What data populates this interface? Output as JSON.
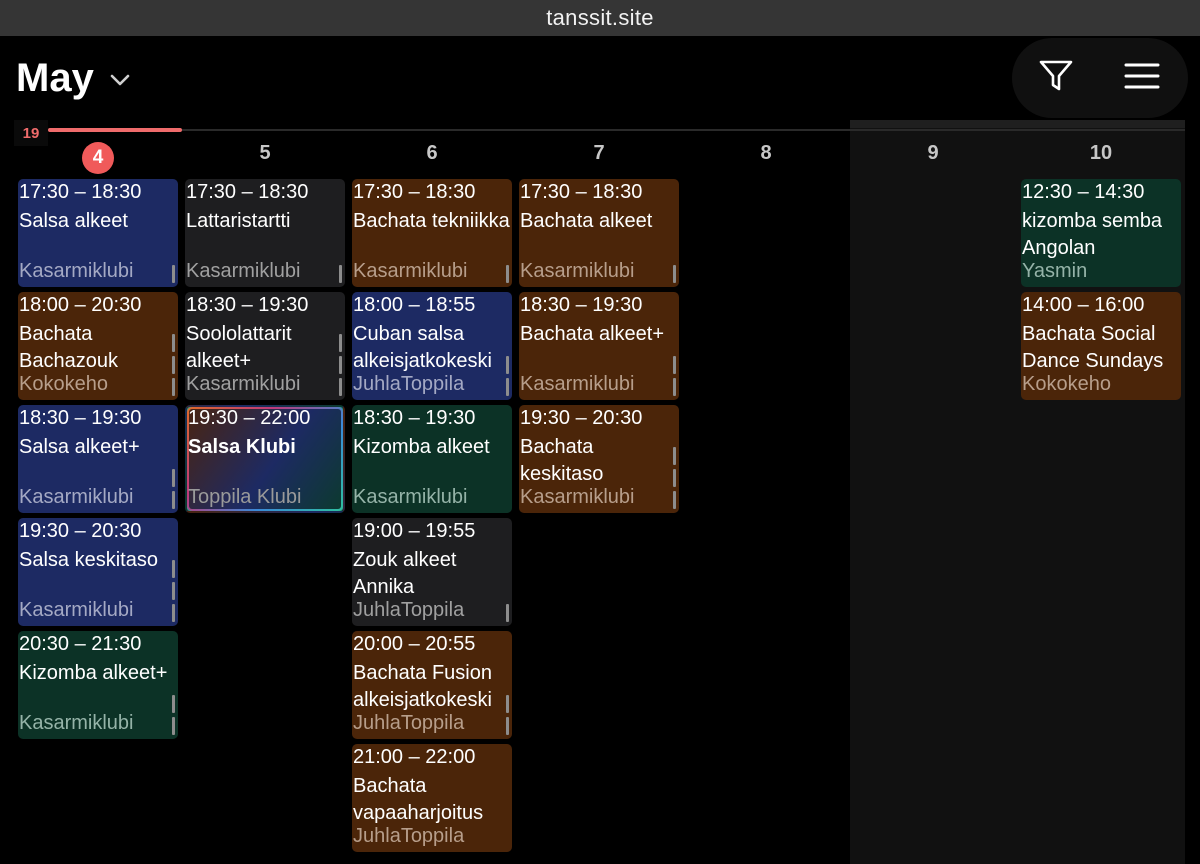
{
  "browser": {
    "url": "tanssit.site"
  },
  "header": {
    "month": "May",
    "month_icon": "chevron-down-icon",
    "filter_icon": "filter-icon",
    "menu_icon": "hamburger-menu-icon"
  },
  "week": {
    "number": "19"
  },
  "days": [
    {
      "label": "4",
      "today": true
    },
    {
      "label": "5"
    },
    {
      "label": "6"
    },
    {
      "label": "7"
    },
    {
      "label": "8"
    },
    {
      "label": "9"
    },
    {
      "label": "10"
    }
  ],
  "events": {
    "d4": [
      {
        "time": "17:30 – 18:30",
        "name": "Salsa alkeet",
        "location": "Kasarmiklubi",
        "color": "#1d2a63"
      },
      {
        "time": "18:00 – 20:30",
        "name": "Bachata Bachazouk",
        "location": "Kokokeho",
        "color": "#4b2509"
      },
      {
        "time": "18:30 – 19:30",
        "name": "Salsa alkeet+",
        "location": "Kasarmiklubi",
        "color": "#1d2a63"
      },
      {
        "time": "19:30 – 20:30",
        "name": "Salsa keskitaso",
        "location": "Kasarmiklubi",
        "color": "#1d2a63"
      },
      {
        "time": "20:30 – 21:30",
        "name": "Kizomba alkeet+",
        "location": "Kasarmiklubi",
        "color": "#0c3226"
      }
    ],
    "d5": [
      {
        "time": "17:30 – 18:30",
        "name": "Lattaristartti",
        "location": "Kasarmiklubi",
        "color": "#1e1e20"
      },
      {
        "time": "18:30 – 19:30",
        "name": "Soololattarit alkeet+",
        "location": "Kasarmiklubi",
        "color": "#1e1e20"
      },
      {
        "time": "19:30 – 22:00",
        "name": "Salsa Klubi",
        "location": "Toppila Klubi",
        "color": "gradient"
      }
    ],
    "d6": [
      {
        "time": "17:30 – 18:30",
        "name": "Bachata tekniikka",
        "location": "Kasarmiklubi",
        "color": "#4b2509"
      },
      {
        "time": "18:00 – 18:55",
        "name": "Cuban salsa alkeisjatkokeski",
        "location": "JuhlaToppila",
        "color": "#1d2a63"
      },
      {
        "time": "18:30 – 19:30",
        "name": "Kizomba alkeet",
        "location": "Kasarmiklubi",
        "color": "#0c3226"
      },
      {
        "time": "19:00 – 19:55",
        "name": "Zouk alkeet Annika",
        "location": "JuhlaToppila",
        "color": "#1e1e20"
      },
      {
        "time": "20:00 – 20:55",
        "name": "Bachata Fusion alkeisjatkokeski",
        "location": "JuhlaToppila",
        "color": "#4b2509"
      },
      {
        "time": "21:00 – 22:00",
        "name": "Bachata vapaaharjoitus",
        "location": "JuhlaToppila",
        "color": "#4b2509"
      }
    ],
    "d7": [
      {
        "time": "17:30 – 18:30",
        "name": "Bachata alkeet",
        "location": "Kasarmiklubi",
        "color": "#4b2509"
      },
      {
        "time": "18:30 – 19:30",
        "name": "Bachata alkeet+",
        "location": "Kasarmiklubi",
        "color": "#4b2509"
      },
      {
        "time": "19:30 – 20:30",
        "name": "Bachata keskitaso",
        "location": "Kasarmiklubi",
        "color": "#4b2509"
      }
    ],
    "d10": [
      {
        "time": "12:30 – 14:30",
        "name": "kizomba semba Angolan",
        "location": "Yasmin",
        "color": "#0c3226"
      },
      {
        "time": "14:00 – 16:00",
        "name": "Bachata Social Dance Sundays",
        "location": "Kokokeho",
        "color": "#4b2509"
      }
    ]
  }
}
